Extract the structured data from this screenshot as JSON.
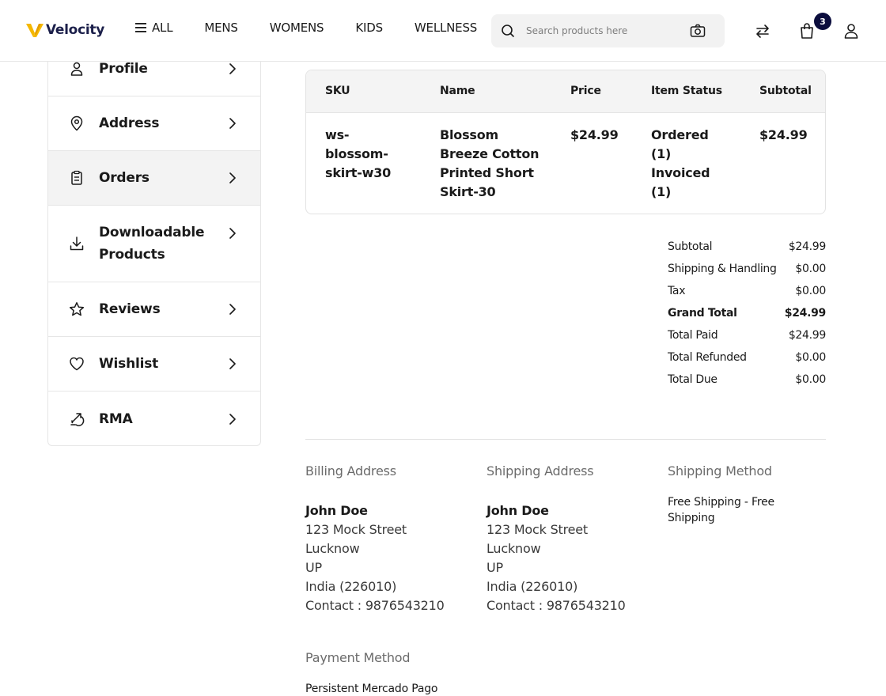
{
  "header": {
    "logo_text": "Velocity",
    "nav": [
      "ALL",
      "MENS",
      "WOMENS",
      "KIDS",
      "WELLNESS"
    ],
    "search_placeholder": "Search products here",
    "cart_count": "3",
    "accent": "#0b0d3d",
    "logo_color": "#f5b800"
  },
  "sidebar": {
    "items": [
      {
        "label": "Profile",
        "icon": "user-icon"
      },
      {
        "label": "Address",
        "icon": "location-pin-icon"
      },
      {
        "label": "Orders",
        "icon": "clipboard-icon",
        "active": true
      },
      {
        "label": "Downloadable Products",
        "icon": "download-icon"
      },
      {
        "label": "Reviews",
        "icon": "star-icon"
      },
      {
        "label": "Wishlist",
        "icon": "heart-icon"
      },
      {
        "label": "RMA",
        "icon": "return-arrows-icon"
      }
    ]
  },
  "items_table": {
    "headers": [
      "SKU",
      "Name",
      "Price",
      "Item Status",
      "Subtotal"
    ],
    "row": {
      "sku": "ws-blossom-skirt-w30",
      "name": "Blossom Breeze Cotton Printed Short Skirt-30",
      "price": "$24.99",
      "status": "Ordered (1) Invoiced (1)",
      "subtotal": "$24.99"
    }
  },
  "totals": [
    {
      "label": "Subtotal",
      "value": "$24.99"
    },
    {
      "label": "Shipping & Handling",
      "value": "$0.00"
    },
    {
      "label": "Tax",
      "value": "$0.00"
    },
    {
      "label": "Grand Total",
      "value": "$24.99",
      "bold": true
    },
    {
      "label": "Total Paid",
      "value": "$24.99"
    },
    {
      "label": "Total Refunded",
      "value": "$0.00"
    },
    {
      "label": "Total Due",
      "value": "$0.00"
    }
  ],
  "billing": {
    "title": "Billing Address",
    "name": "John Doe",
    "street": "123 Mock Street",
    "city": "Lucknow",
    "state": "UP",
    "country": "India (226010)",
    "contact": "Contact : 9876543210"
  },
  "shipping": {
    "title": "Shipping Address",
    "name": "John Doe",
    "street": "123 Mock Street",
    "city": "Lucknow",
    "state": "UP",
    "country": "India (226010)",
    "contact": "Contact : 9876543210"
  },
  "shipping_method": {
    "title": "Shipping Method",
    "value": "Free Shipping - Free Shipping"
  },
  "payment_method": {
    "title": "Payment Method",
    "value": "Persistent Mercado Pago"
  }
}
